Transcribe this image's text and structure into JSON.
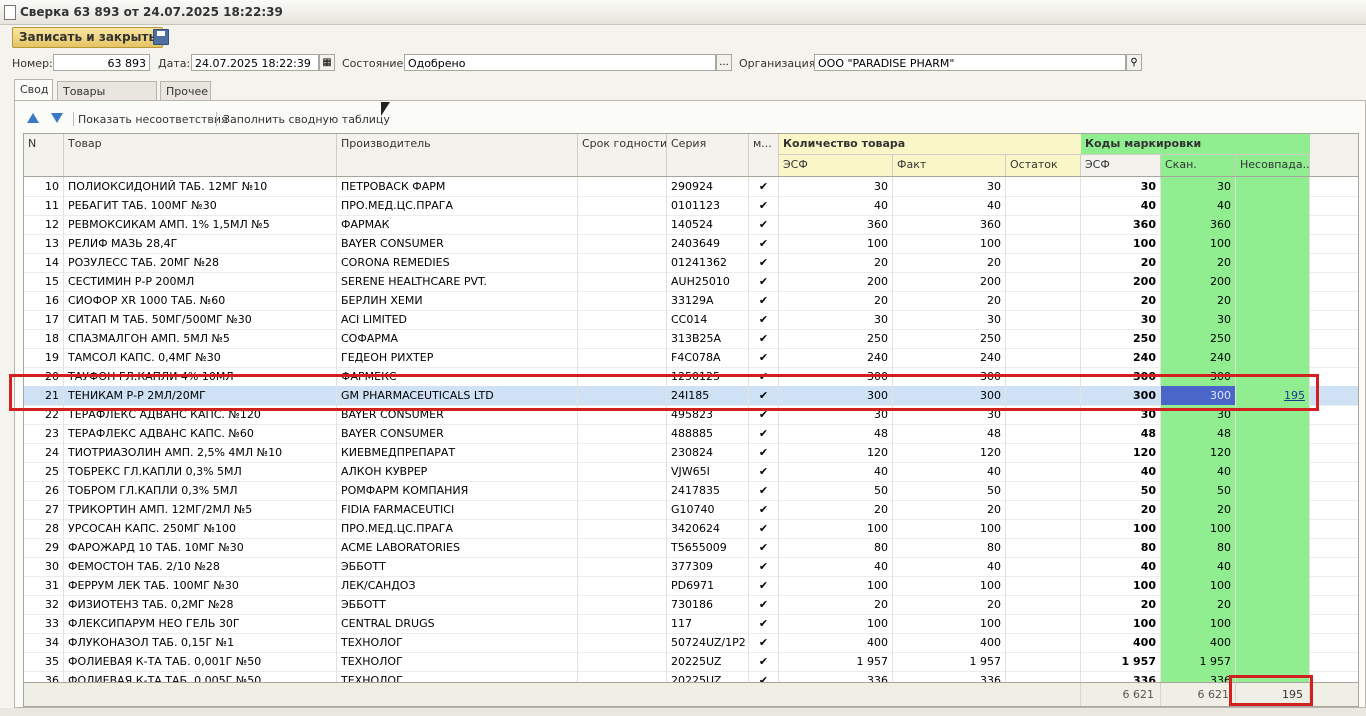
{
  "window": {
    "title": "Сверка 63 893 от 24.07.2025 18:22:39"
  },
  "toolbar": {
    "save_close_label": "Записать и закрыть",
    "save_icon": "floppy-disk-icon"
  },
  "form": {
    "number_label": "Номер:",
    "number_value": "63 893",
    "date_label": "Дата:",
    "date_value": "24.07.2025 18:22:39",
    "state_label": "Состояние:",
    "state_value": "Одобрено",
    "state_button": "...",
    "org_label": "Организация:",
    "org_value": "ООО \"PARADISE PHARM\""
  },
  "tabs": [
    {
      "label": "Свод",
      "active": true
    },
    {
      "label": "Товары фактуры"
    },
    {
      "label": "Прочее"
    }
  ],
  "commands": {
    "show_mismatch": "Показать несоответствия",
    "fill_summary": "Заполнить сводную таблицу"
  },
  "grid": {
    "headers": {
      "n": "N",
      "product": "Товар",
      "manufacturer": "Производитель",
      "expiry": "Срок годности",
      "series": "Серия",
      "m": "м...",
      "qty_group": "Количество товара",
      "qty_esf": "ЭСФ",
      "qty_fact": "Факт",
      "qty_rest": "Остаток",
      "codes_group": "Коды маркировки",
      "codes_esf": "ЭСФ",
      "codes_scan": "Скан.",
      "codes_mismatch": "Несовпада..."
    },
    "check_mark": "✔",
    "rows": [
      {
        "n": "10",
        "product": "ПОЛИОКСИДОНИЙ ТАБ. 12МГ №10",
        "manufacturer": "ПЕТРОВАСК ФАРМ",
        "series": "290924",
        "esf": "30",
        "fact": "30",
        "c_esf": "30",
        "scan": "30",
        "mis": ""
      },
      {
        "n": "11",
        "product": "РЕБАГИТ ТАБ. 100МГ №30",
        "manufacturer": "ПРО.МЕД.ЦС.ПРАГА",
        "series": "0101123",
        "esf": "40",
        "fact": "40",
        "c_esf": "40",
        "scan": "40",
        "mis": ""
      },
      {
        "n": "12",
        "product": "РЕВМОКСИКАМ АМП. 1% 1,5МЛ №5",
        "manufacturer": "ФАРМАК",
        "series": "140524",
        "esf": "360",
        "fact": "360",
        "c_esf": "360",
        "scan": "360",
        "mis": ""
      },
      {
        "n": "13",
        "product": "РЕЛИФ МАЗЬ 28,4Г",
        "manufacturer": "BAYER CONSUMER",
        "series": "2403649",
        "esf": "100",
        "fact": "100",
        "c_esf": "100",
        "scan": "100",
        "mis": ""
      },
      {
        "n": "14",
        "product": "РОЗУЛЕСС ТАБ. 20МГ №28",
        "manufacturer": "CORONA REMEDIES",
        "series": "01241362",
        "esf": "20",
        "fact": "20",
        "c_esf": "20",
        "scan": "20",
        "mis": ""
      },
      {
        "n": "15",
        "product": "СЕСТИМИН Р-Р 200МЛ",
        "manufacturer": "SERENE HEALTHCARE PVT.",
        "series": "AUH25010",
        "esf": "200",
        "fact": "200",
        "c_esf": "200",
        "scan": "200",
        "mis": ""
      },
      {
        "n": "16",
        "product": "СИОФОР XR 1000 ТАБ. №60",
        "manufacturer": "БЕРЛИН ХЕМИ",
        "series": "33129A",
        "esf": "20",
        "fact": "20",
        "c_esf": "20",
        "scan": "20",
        "mis": ""
      },
      {
        "n": "17",
        "product": "СИТАП М ТАБ. 50МГ/500МГ №30",
        "manufacturer": "ACI LIMITED",
        "series": "CC014",
        "esf": "30",
        "fact": "30",
        "c_esf": "30",
        "scan": "30",
        "mis": ""
      },
      {
        "n": "18",
        "product": "СПАЗМАЛГОН АМП. 5МЛ №5",
        "manufacturer": "СОФАРМА",
        "series": "313B25A",
        "esf": "250",
        "fact": "250",
        "c_esf": "250",
        "scan": "250",
        "mis": ""
      },
      {
        "n": "19",
        "product": "ТАМСОЛ КАПС. 0,4МГ №30",
        "manufacturer": "ГЕДЕОН РИХТЕР",
        "series": "F4C078A",
        "esf": "240",
        "fact": "240",
        "c_esf": "240",
        "scan": "240",
        "mis": ""
      },
      {
        "n": "20",
        "product": "ТАУФОН ГЛ.КАПЛИ 4% 10МЛ",
        "manufacturer": "ФАРМЕКС",
        "series": "1250125",
        "esf": "300",
        "fact": "300",
        "c_esf": "300",
        "scan": "300",
        "mis": ""
      },
      {
        "n": "21",
        "product": "ТЕНИКАМ Р-Р 2МЛ/20МГ",
        "manufacturer": "GM PHARMACEUTICALS LTD",
        "series": "24I185",
        "esf": "300",
        "fact": "300",
        "c_esf": "300",
        "scan": "300",
        "mis": "195",
        "selected": true
      },
      {
        "n": "22",
        "product": "ТЕРАФЛЕКС АДВАНС КАПС. №120",
        "manufacturer": "BAYER CONSUMER",
        "series": "495823",
        "esf": "30",
        "fact": "30",
        "c_esf": "30",
        "scan": "30",
        "mis": ""
      },
      {
        "n": "23",
        "product": "ТЕРАФЛЕКС АДВАНС КАПС. №60",
        "manufacturer": "BAYER CONSUMER",
        "series": "488885",
        "esf": "48",
        "fact": "48",
        "c_esf": "48",
        "scan": "48",
        "mis": ""
      },
      {
        "n": "24",
        "product": "ТИОТРИАЗОЛИН АМП. 2,5% 4МЛ №10",
        "manufacturer": "КИЕВМЕДПРЕПАРАТ",
        "series": "230824",
        "esf": "120",
        "fact": "120",
        "c_esf": "120",
        "scan": "120",
        "mis": ""
      },
      {
        "n": "25",
        "product": "ТОБРЕКС ГЛ.КАПЛИ 0,3% 5МЛ",
        "manufacturer": "АЛКОН КУВРЕР",
        "series": "VJW65I",
        "esf": "40",
        "fact": "40",
        "c_esf": "40",
        "scan": "40",
        "mis": ""
      },
      {
        "n": "26",
        "product": "ТОБРОМ ГЛ.КАПЛИ 0,3% 5МЛ",
        "manufacturer": "РОМФАРМ КОМПАНИЯ",
        "series": "2417835",
        "esf": "50",
        "fact": "50",
        "c_esf": "50",
        "scan": "50",
        "mis": ""
      },
      {
        "n": "27",
        "product": "ТРИКОРТИН АМП. 12МГ/2МЛ №5",
        "manufacturer": "FIDIA FARMACEUTICI",
        "series": "G10740",
        "esf": "20",
        "fact": "20",
        "c_esf": "20",
        "scan": "20",
        "mis": ""
      },
      {
        "n": "28",
        "product": "УРСОСАН КАПС. 250МГ №100",
        "manufacturer": "ПРО.МЕД.ЦС.ПРАГА",
        "series": "3420624",
        "esf": "100",
        "fact": "100",
        "c_esf": "100",
        "scan": "100",
        "mis": ""
      },
      {
        "n": "29",
        "product": "ФАРОЖАРД 10 ТАБ. 10МГ №30",
        "manufacturer": "ACME LABORATORIES",
        "series": "T5655009",
        "esf": "80",
        "fact": "80",
        "c_esf": "80",
        "scan": "80",
        "mis": ""
      },
      {
        "n": "30",
        "product": "ФЕМОСТОН ТАБ. 2/10 №28",
        "manufacturer": "ЭББОТТ",
        "series": "377309",
        "esf": "40",
        "fact": "40",
        "c_esf": "40",
        "scan": "40",
        "mis": ""
      },
      {
        "n": "31",
        "product": "ФЕРРУМ ЛЕК ТАБ. 100МГ №30",
        "manufacturer": "ЛЕК/САНДОЗ",
        "series": "PD6971",
        "esf": "100",
        "fact": "100",
        "c_esf": "100",
        "scan": "100",
        "mis": ""
      },
      {
        "n": "32",
        "product": "ФИЗИОТЕНЗ ТАБ. 0,2МГ №28",
        "manufacturer": "ЭББОТТ",
        "series": "730186",
        "esf": "20",
        "fact": "20",
        "c_esf": "20",
        "scan": "20",
        "mis": ""
      },
      {
        "n": "33",
        "product": "ФЛЕКСИПАРУМ НЕО ГЕЛЬ 30Г",
        "manufacturer": "CENTRAL DRUGS",
        "series": "117",
        "esf": "100",
        "fact": "100",
        "c_esf": "100",
        "scan": "100",
        "mis": ""
      },
      {
        "n": "34",
        "product": "ФЛУКОНАЗОЛ ТАБ. 0,15Г №1",
        "manufacturer": "ТЕХНОЛОГ",
        "series": "50724UZ/1P2",
        "esf": "400",
        "fact": "400",
        "c_esf": "400",
        "scan": "400",
        "mis": ""
      },
      {
        "n": "35",
        "product": "ФОЛИЕВАЯ К-ТА ТАБ. 0,001Г №50",
        "manufacturer": "ТЕХНОЛОГ",
        "series": "20225UZ",
        "esf": "1 957",
        "fact": "1 957",
        "c_esf": "1 957",
        "scan": "1 957",
        "mis": ""
      },
      {
        "n": "36",
        "product": "ФОЛИЕВАЯ К-ТА ТАБ. 0,005Г №50",
        "manufacturer": "ТЕХНОЛОГ",
        "series": "20225UZ",
        "esf": "336",
        "fact": "336",
        "c_esf": "336",
        "scan": "336",
        "mis": ""
      }
    ],
    "totals": {
      "codes_esf": "6 621",
      "codes_scan": "6 621",
      "codes_mismatch": "195"
    }
  }
}
